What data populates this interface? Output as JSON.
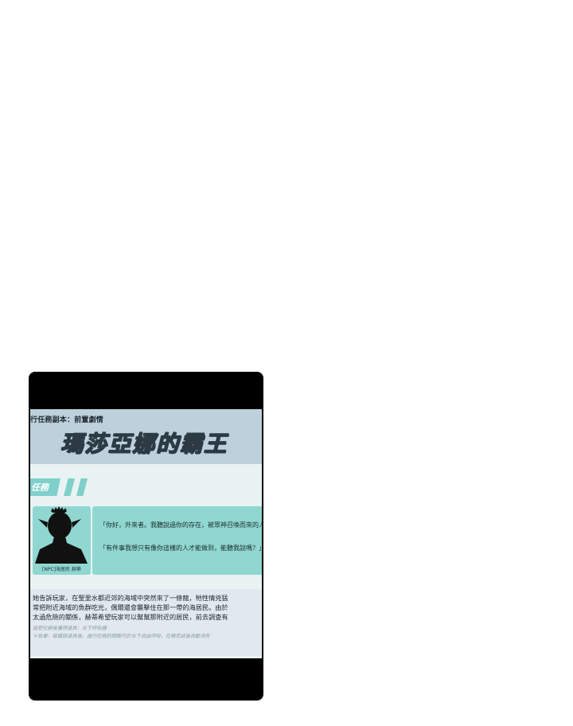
{
  "header": {
    "subtitle": "行任務副本：前置劇情",
    "title": "瑪莎亞娜的霸王"
  },
  "quest": {
    "label": "任務"
  },
  "npc": {
    "name": "[NPC]海居民 赫蒂"
  },
  "dialogue": {
    "line1": "「你好，外來者。我聽說過你的存在，被眾神召喚而來的人。」",
    "line2": "「有件事我想只有像你這樣的人才能做到，能聽我說嗎？」"
  },
  "description": {
    "line1": "她告訴玩家，在聖里水都近郊的海域中突然來了一條龍，牠性情兇猛",
    "line2": "常把附近海域的魚群吃光，偶爾還會襲擊住在那一帶的海居民。由於",
    "line3": "太過危險的關係，赫蒂希望玩家可以幫幫那附近的居民，前去調查有",
    "note1": "接受任務後獲得道具：水下呼吸器",
    "note2": "＊效果：裝備該道具後，進行任務的期間可於水下自由呼吸，任務完成後自動消失"
  },
  "colors": {
    "frame": "#000000",
    "header_bg": "#bdd0dc",
    "accent": "#8fd7d0",
    "desc_bg": "#e1e9ef"
  }
}
